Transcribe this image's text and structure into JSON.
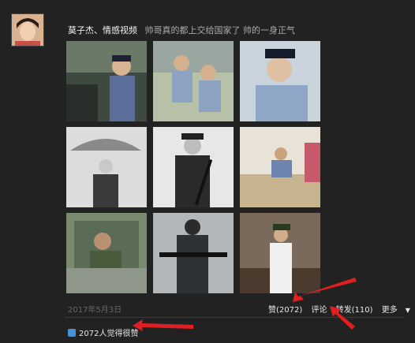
{
  "post": {
    "author": "莫子杰、情感视频",
    "text": "帅哥真的都上交给国家了 帅的一身正气",
    "date": "2017年5月3日"
  },
  "photos": [
    {
      "label": "police-officer-cap-photo"
    },
    {
      "label": "police-subway-photo"
    },
    {
      "label": "police-portrait-photo"
    },
    {
      "label": "umbrella-officer-photo"
    },
    {
      "label": "rifle-guard-photo"
    },
    {
      "label": "office-desk-photo"
    },
    {
      "label": "soldier-car-window-photo"
    },
    {
      "label": "armed-police-photo"
    },
    {
      "label": "honor-guard-photo"
    }
  ],
  "actions": {
    "like": "赞(2072)",
    "comment": "评论",
    "repost": "转发(110)",
    "more": "更多"
  },
  "likes_summary": "2072人觉得很赞",
  "colors": {
    "arrow": "#e02020",
    "thumb": "#4a8fd8"
  }
}
